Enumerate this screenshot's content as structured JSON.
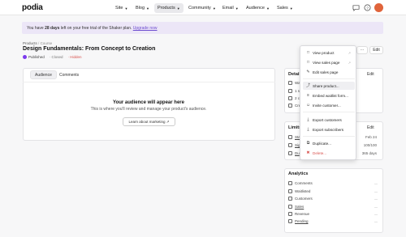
{
  "app": {
    "logo": "podia"
  },
  "nav": [
    {
      "label": "Site"
    },
    {
      "label": "Blog"
    },
    {
      "label": "Products"
    },
    {
      "label": "Community"
    },
    {
      "label": "Email"
    },
    {
      "label": "Audience"
    },
    {
      "label": "Sales"
    }
  ],
  "banner": {
    "prefix": "You have ",
    "days": "28 days",
    "middle": " left on your free trial of the Shaker plan. ",
    "link": "Upgrade now"
  },
  "breadcrumb": {
    "root": "Products",
    "sep": "/",
    "current": "Course"
  },
  "product": {
    "title": "Design Fundamentals: From Concept to Creation",
    "status_published": "Published",
    "status_closed": "Closed",
    "status_hidden": "Hidden"
  },
  "header_actions": {
    "more": "···",
    "edit": "Edit"
  },
  "tabs": [
    {
      "label": "Audience"
    },
    {
      "label": "Comments"
    }
  ],
  "empty": {
    "title": "Your audience will appear here",
    "subtitle": "This is where you'll review and manage your product's audience.",
    "button": "Learn about marketing ↗"
  },
  "details": {
    "title": "Details",
    "edit": "Edit",
    "rows": [
      "Wa",
      "1 se",
      "2 ch",
      "Cre"
    ]
  },
  "limits": {
    "title": "Limits",
    "edit": "Edit",
    "rows": [
      {
        "label": "Sta",
        "value": "Feb 24"
      },
      {
        "label": "Sig",
        "value": "100/100"
      },
      {
        "label": "Du",
        "value": "365 days"
      }
    ]
  },
  "analytics": {
    "title": "Analytics",
    "rows": [
      "Comments",
      "Waitlisted",
      "Customers",
      "Sales",
      "Revenue",
      "Pending"
    ]
  },
  "menu": {
    "items": [
      {
        "label": "View product",
        "icon": "□"
      },
      {
        "label": "View sales page",
        "icon": "□"
      },
      {
        "label": "Edit sales page",
        "icon": "✎"
      },
      {
        "label": "Share product...",
        "icon": "⤴"
      },
      {
        "label": "Embed waitlist form...",
        "icon": "≡"
      },
      {
        "label": "Invite customer...",
        "icon": "☺"
      },
      {
        "label": "Export customers",
        "icon": "⤓"
      },
      {
        "label": "Export subscribers",
        "icon": "⤓"
      },
      {
        "label": "Duplicate...",
        "icon": "⧉"
      },
      {
        "label": "Delete...",
        "icon": "✖"
      }
    ]
  },
  "colors": {
    "accent": "#6d4ccf",
    "danger": "#d9534f",
    "avatar": "#e0643b",
    "banner": "#ece6f7"
  }
}
